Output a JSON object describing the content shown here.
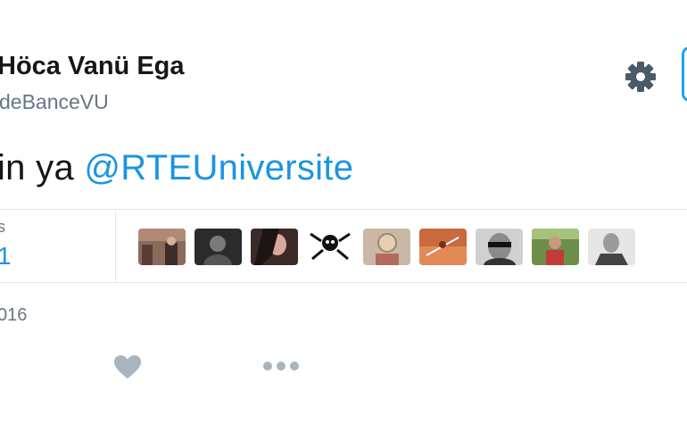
{
  "profile": {
    "display_name": "Höca Vanü Ega",
    "handle": "deBanceVU"
  },
  "tweet": {
    "text_before": "in ya ",
    "mention": "@RTEUniversite"
  },
  "stats": {
    "label": "s",
    "value": "1"
  },
  "likers": [
    {
      "name": "liker-1"
    },
    {
      "name": "liker-2"
    },
    {
      "name": "liker-3"
    },
    {
      "name": "liker-4"
    },
    {
      "name": "liker-5"
    },
    {
      "name": "liker-6"
    },
    {
      "name": "liker-7"
    },
    {
      "name": "liker-8"
    },
    {
      "name": "liker-9"
    }
  ],
  "timestamp": "016",
  "icons": {
    "settings": "gear-icon",
    "like": "heart-icon",
    "more": "more-icon"
  },
  "colors": {
    "accent": "#1b95e0",
    "muted": "#657786",
    "text": "#14171a"
  }
}
